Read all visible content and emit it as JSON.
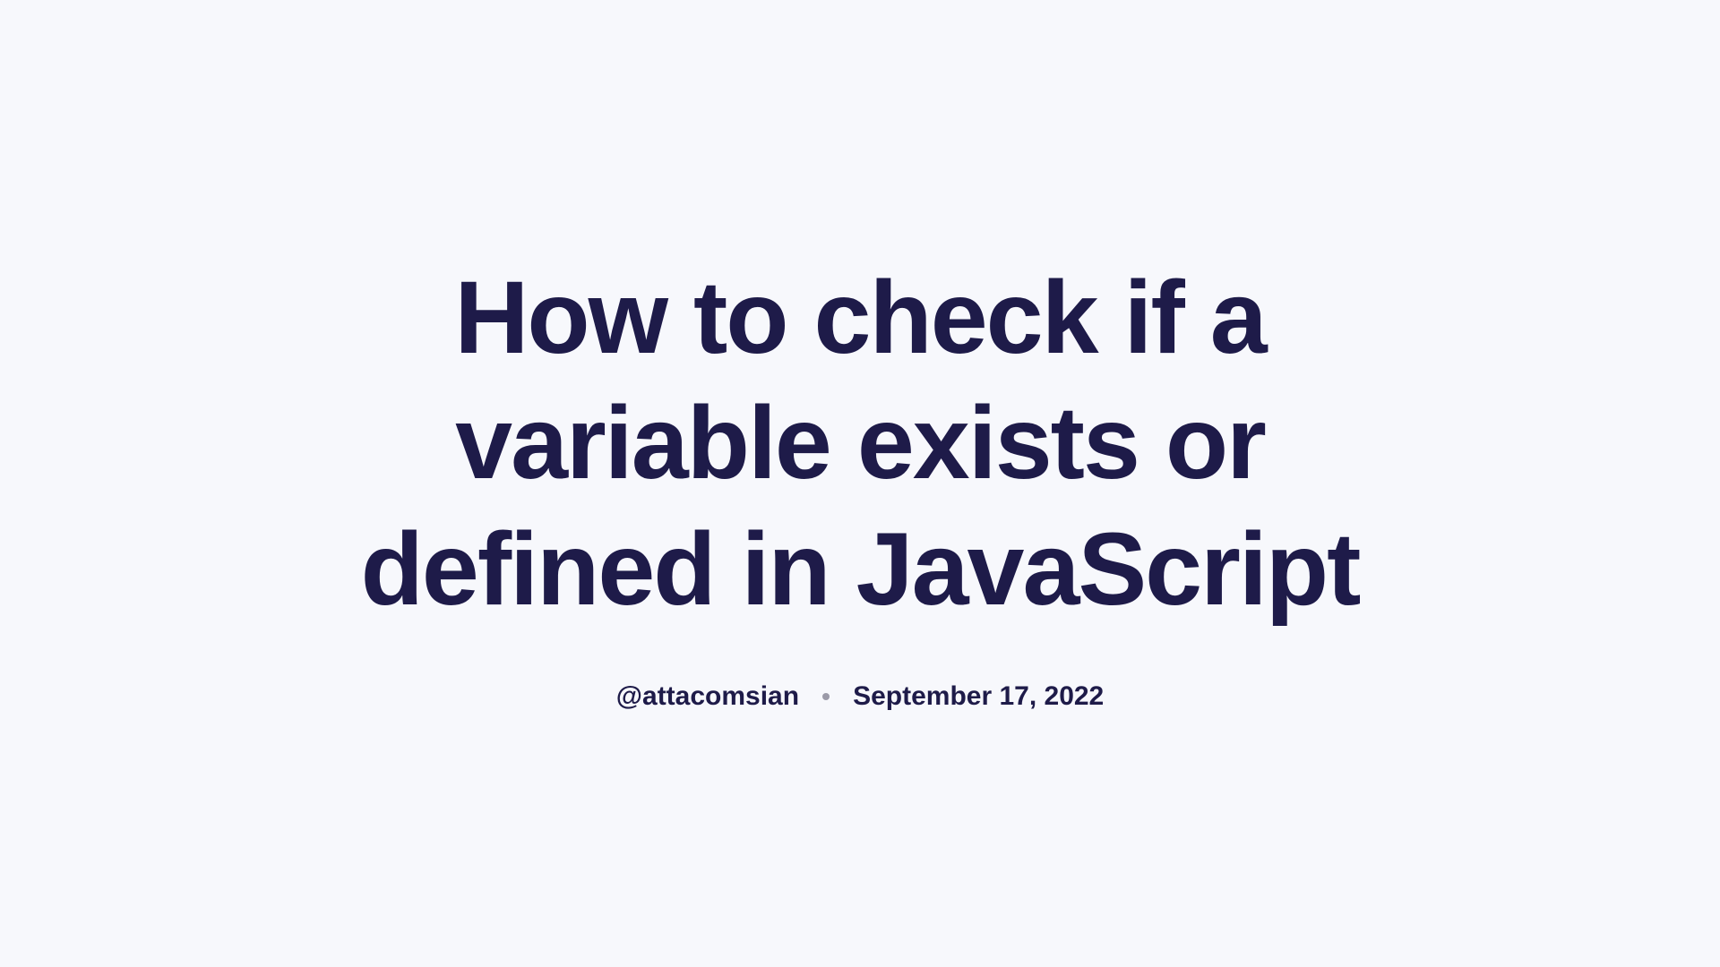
{
  "article": {
    "title": "How to check if a variable exists or defined in JavaScript",
    "author": "@attacomsian",
    "date": "September 17, 2022"
  }
}
